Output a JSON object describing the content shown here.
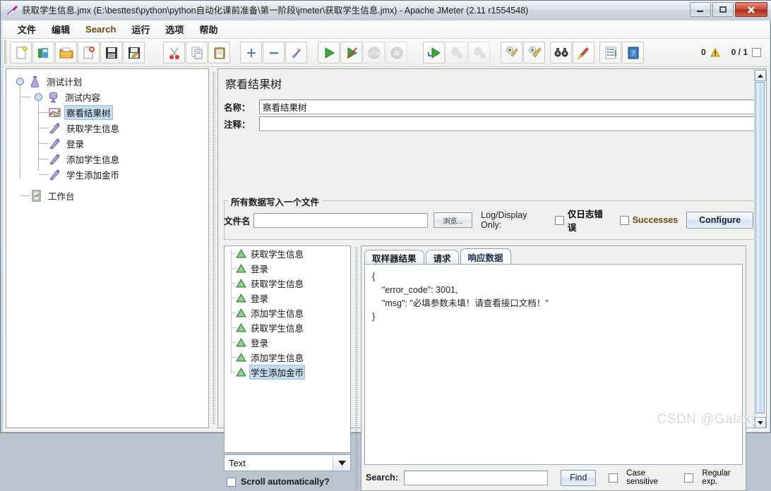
{
  "window": {
    "title": "获取学生信息.jmx (E:\\besttest\\python\\python自动化课前准备\\第一阶段\\jmeter\\获取学生信息.jmx) - Apache JMeter (2.11 r1554548)",
    "app_icon": "jmeter-feather-icon",
    "minimize": "—",
    "maximize": "❐",
    "close": "✕"
  },
  "menubar": {
    "items": [
      {
        "label": "文件",
        "name": "menu-file"
      },
      {
        "label": "编辑",
        "name": "menu-edit"
      },
      {
        "label": "Search",
        "name": "menu-search"
      },
      {
        "label": "运行",
        "name": "menu-run"
      },
      {
        "label": "选项",
        "name": "menu-options"
      },
      {
        "label": "帮助",
        "name": "menu-help"
      }
    ]
  },
  "toolbar": {
    "buttons": [
      {
        "icon": "new-document-icon",
        "name": "toolbar-new"
      },
      {
        "icon": "templates-icon",
        "name": "toolbar-templates"
      },
      {
        "icon": "open-folder-icon",
        "name": "toolbar-open"
      },
      {
        "icon": "close-document-icon",
        "name": "toolbar-close"
      },
      {
        "icon": "save-icon",
        "name": "toolbar-save"
      },
      {
        "icon": "save-as-icon",
        "name": "toolbar-save-as"
      },
      {
        "icon": "cut-scissors-icon",
        "name": "toolbar-cut"
      },
      {
        "icon": "copy-icon",
        "name": "toolbar-copy"
      },
      {
        "icon": "paste-clipboard-icon",
        "name": "toolbar-paste"
      },
      {
        "icon": "expand-plus-icon",
        "name": "toolbar-expand"
      },
      {
        "icon": "collapse-minus-icon",
        "name": "toolbar-collapse"
      },
      {
        "icon": "toggle-icon",
        "name": "toolbar-toggle"
      },
      {
        "icon": "start-play-icon",
        "name": "toolbar-start"
      },
      {
        "icon": "start-no-timers-icon",
        "name": "toolbar-start-no-pauses"
      },
      {
        "icon": "stop-icon",
        "name": "toolbar-stop"
      },
      {
        "icon": "shutdown-icon",
        "name": "toolbar-shutdown"
      },
      {
        "icon": "remote-start-icon",
        "name": "toolbar-remote-start"
      },
      {
        "icon": "remote-stop-icon",
        "name": "toolbar-remote-stop"
      },
      {
        "icon": "remote-shutdown-icon",
        "name": "toolbar-remote-shutdown"
      },
      {
        "icon": "clear-broom-icon",
        "name": "toolbar-clear"
      },
      {
        "icon": "clear-all-broom-icon",
        "name": "toolbar-clear-all"
      },
      {
        "icon": "search-binoculars-icon",
        "name": "toolbar-search"
      },
      {
        "icon": "reset-search-broom-icon",
        "name": "toolbar-reset-search"
      },
      {
        "icon": "function-helper-icon",
        "name": "toolbar-function-helper"
      },
      {
        "icon": "help-book-icon",
        "name": "toolbar-help"
      }
    ],
    "warning_count": "0",
    "warning_icon": "warning-triangle-icon",
    "thread_count": "0 / 1"
  },
  "tree": {
    "nodes": [
      {
        "label": "测试计划",
        "icon": "test-plan-icon",
        "depth": 0,
        "selected": false,
        "name": "tree-node-test-plan"
      },
      {
        "label": "测试内容",
        "icon": "thread-group-icon",
        "depth": 1,
        "selected": false,
        "name": "tree-node-thread-group"
      },
      {
        "label": "察看结果树",
        "icon": "view-results-tree-icon",
        "depth": 2,
        "selected": true,
        "name": "tree-node-view-results-tree"
      },
      {
        "label": "获取学生信息",
        "icon": "http-sampler-icon",
        "depth": 2,
        "selected": false,
        "name": "tree-node-get-student-info"
      },
      {
        "label": "登录",
        "icon": "http-sampler-icon",
        "depth": 2,
        "selected": false,
        "name": "tree-node-login"
      },
      {
        "label": "添加学生信息",
        "icon": "http-sampler-icon",
        "depth": 2,
        "selected": false,
        "name": "tree-node-add-student-info"
      },
      {
        "label": "学生添加金币",
        "icon": "http-sampler-icon",
        "depth": 2,
        "selected": false,
        "name": "tree-node-add-gold"
      },
      {
        "label": "工作台",
        "icon": "workbench-icon",
        "depth": 0,
        "selected": false,
        "name": "tree-node-workbench"
      }
    ]
  },
  "panel": {
    "title": "察看结果树",
    "name_label": "名称：",
    "name_value": "察看结果树",
    "comment_label": "注释：",
    "comment_value": "",
    "filegroup_title": "所有数据写入一个文件",
    "filename_label": "文件名",
    "filename_value": "",
    "browse_button": "浏览...",
    "logdisplay_label": "Log/Display Only:",
    "errors_only_label": "仅日志错误",
    "successes_label": "Successes",
    "configure_button": "Configure"
  },
  "results": {
    "items": [
      {
        "label": "获取学生信息",
        "selected": false,
        "status": "success"
      },
      {
        "label": "登录",
        "selected": false,
        "status": "success"
      },
      {
        "label": "获取学生信息",
        "selected": false,
        "status": "success"
      },
      {
        "label": "登录",
        "selected": false,
        "status": "success"
      },
      {
        "label": "添加学生信息",
        "selected": false,
        "status": "success"
      },
      {
        "label": "获取学生信息",
        "selected": false,
        "status": "success"
      },
      {
        "label": "登录",
        "selected": false,
        "status": "success"
      },
      {
        "label": "添加学生信息",
        "selected": false,
        "status": "success"
      },
      {
        "label": "学生添加金币",
        "selected": true,
        "status": "success"
      }
    ],
    "renderer_value": "Text",
    "renderer_arrow_icon": "chevron-down-icon",
    "scroll_auto_label": "Scroll automatically?"
  },
  "detail": {
    "tabs": [
      {
        "label": "取样器结果",
        "active": false,
        "name": "tab-sampler-result"
      },
      {
        "label": "请求",
        "active": false,
        "name": "tab-request"
      },
      {
        "label": "响应数据",
        "active": true,
        "name": "tab-response-data"
      }
    ],
    "response_body": "{\n    \"error_code\": 3001,\n    \"msg\": \"必填参数未填！请查看接口文档！\"\n}",
    "search_label": "Search:",
    "search_value": "",
    "find_button": "Find",
    "case_sensitive_label": "Case sensitive",
    "regular_exp_label": "Regular exp."
  },
  "watermark": "CSDN @Galaxy"
}
